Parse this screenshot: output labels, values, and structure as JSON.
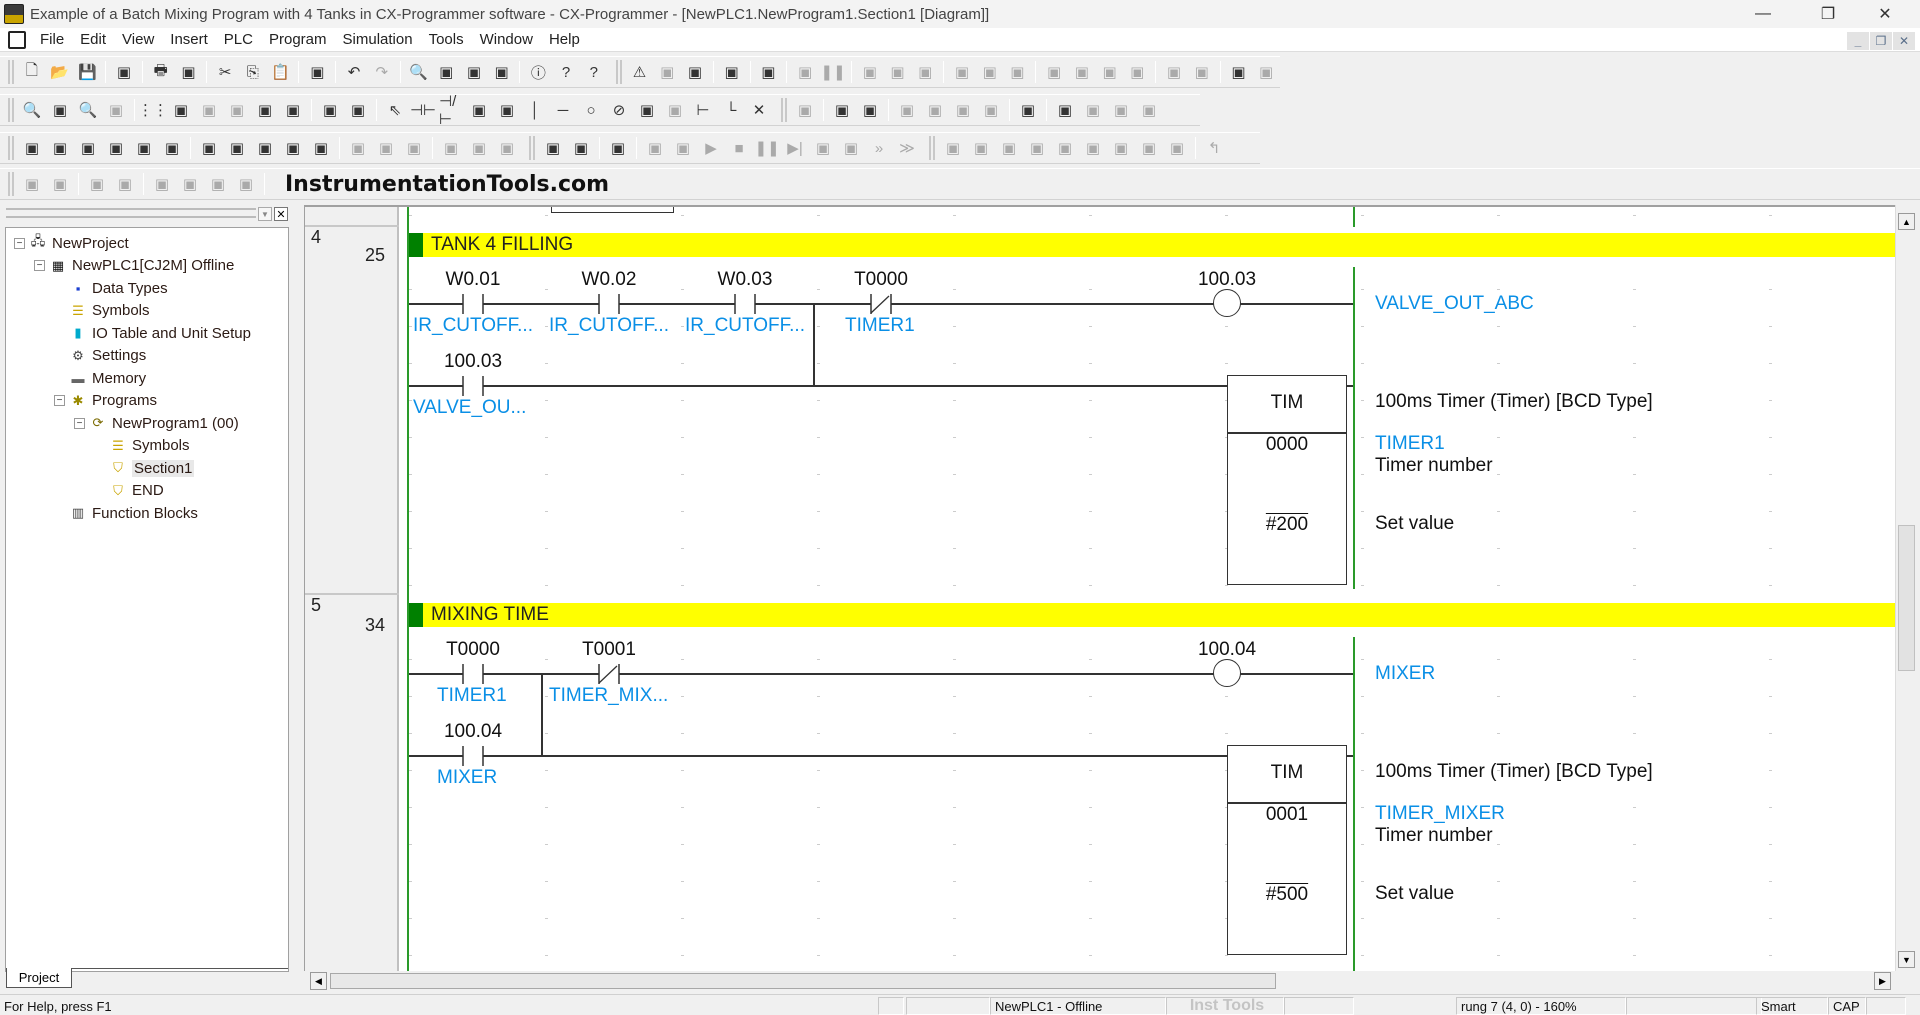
{
  "window": {
    "title": "Example of a Batch Mixing Program with 4 Tanks in CX-Programmer software - CX-Programmer - [NewPLC1.NewProgram1.Section1 [Diagram]]",
    "minimize": "—",
    "restore": "❐",
    "close": "✕"
  },
  "menu": {
    "items": [
      "File",
      "Edit",
      "View",
      "Insert",
      "PLC",
      "Program",
      "Simulation",
      "Tools",
      "Window",
      "Help"
    ],
    "mdi_minimize": "_",
    "mdi_restore": "❐",
    "mdi_close": "✕"
  },
  "toolbar": {
    "watermark": "InstrumentationTools.com",
    "row1": [
      "new-icon",
      "open-icon",
      "save-icon",
      "|",
      "print-preview-project-icon",
      "|",
      "print-icon",
      "print-preview-icon",
      "|",
      "cut-icon",
      "copy-icon",
      "paste-icon",
      "|",
      "paste-special-icon",
      "|",
      "undo-icon",
      "redo-icon",
      "|",
      "find-icon",
      "replace-icon",
      "address-reference-icon",
      "cross-reference-icon",
      "|",
      "info-icon",
      "help-icon",
      "whats-this-icon",
      "||",
      "compile-warning-icon",
      "online-compile-icon",
      "find-error-icon",
      "|",
      "program-check-icon",
      "|",
      "plc-check-icon",
      "|",
      "stop-monitoring-icon",
      "pause-icon",
      "|",
      "transfer-to-plc-icon",
      "transfer-from-plc-icon",
      "compare-icon",
      "|",
      "online-edit-icon",
      "online-edit-send-icon",
      "online-edit-cancel-icon",
      "|",
      "memory-card-icon",
      "data-trace-icon",
      "time-chart-icon",
      "memory-compare-icon",
      "|",
      "differential-monitor-icon",
      "io-monitor-icon",
      "|",
      "protect-icon",
      "release-protect-icon"
    ],
    "row2": [
      "zoom-out-icon",
      "zoom-fit-icon",
      "zoom-in-icon",
      "zoom-disabled-icon",
      "|",
      "grid-icon",
      "show-comments-icon",
      "rung-annotation-icon",
      "monitor-rungs-icon",
      "program-ladder-icon",
      "show-tree-icon",
      "|",
      "sma-icon",
      "ci-icon",
      "|",
      "select-icon",
      "contact-no-icon",
      "contact-nc-icon",
      "contact-or-no-icon",
      "contact-or-nc-icon",
      "vertical-line-icon",
      "horizontal-line-icon",
      "coil-no-icon",
      "coil-nc-icon",
      "instruction-icon",
      "ladder-block-icon",
      "branch-icon",
      "connect-line-icon",
      "delete-line-icon",
      "||",
      "simulation-icon",
      "|",
      "download-icon",
      "upload-icon",
      "|",
      "force-on-icon",
      "force-off-icon",
      "force-cancel-icon",
      "force-all-icon",
      "|",
      "io-table-icon",
      "|",
      "data-monitor-icon",
      "set-on-icon",
      "set-off-icon",
      "set-value-icon"
    ],
    "row3": [
      "project-window-icon",
      "build-icon",
      "ladder-view-icon",
      "mnemonic-view-icon",
      "output-window-icon",
      "properties-icon",
      "|",
      "cross-ref-icon",
      "symbols-window-icon",
      "io-comment-icon",
      "watch-window-icon",
      "address-icon",
      "|",
      "decimal-icon",
      "signed-decimal-icon",
      "hex-icon",
      "|",
      "step-in-icon",
      "step-out-icon",
      "step-over-icon",
      "||",
      "connect-online-icon",
      "work-online-icon",
      "|",
      "monitor-icon",
      "|",
      "hand-icon",
      "hand-step-icon",
      "run-icon",
      "stop-icon",
      "pause-icon",
      "step-icon",
      "step-in-sim-icon",
      "step-out-sim-icon",
      "fast-forward-icon",
      "last-step-icon",
      "||",
      "block-icon-1",
      "block-icon-2",
      "block-icon-3",
      "block-icon-4",
      "branch-icon-1",
      "branch-icon-2",
      "branch-icon-3",
      "branch-icon-4",
      "branch-icon-5",
      "|",
      "return-icon"
    ],
    "row4": [
      "indent-left-icon",
      "indent-right-icon",
      "|",
      "list-icon",
      "list-check-icon",
      "|",
      "action-icon-1",
      "action-icon-2",
      "action-icon-3",
      "action-icon-4"
    ]
  },
  "project_panel": {
    "tab": "Project",
    "tree": [
      {
        "label": "NewProject",
        "icon": "project-icon",
        "level": 0,
        "expanded": true
      },
      {
        "label": "NewPLC1[CJ2M] Offline",
        "icon": "plc-icon",
        "level": 1,
        "expanded": true
      },
      {
        "label": "Data Types",
        "icon": "data-types-icon",
        "level": 2
      },
      {
        "label": "Symbols",
        "icon": "symbols-icon",
        "level": 2
      },
      {
        "label": "IO Table and Unit Setup",
        "icon": "io-table-icon",
        "level": 2
      },
      {
        "label": "Settings",
        "icon": "settings-icon",
        "level": 2
      },
      {
        "label": "Memory",
        "icon": "memory-icon",
        "level": 2
      },
      {
        "label": "Programs",
        "icon": "programs-icon",
        "level": 2,
        "expanded": true
      },
      {
        "label": "NewProgram1 (00)",
        "icon": "program-icon",
        "level": 3,
        "expanded": true
      },
      {
        "label": "Symbols",
        "icon": "symbols-icon",
        "level": 4
      },
      {
        "label": "Section1",
        "icon": "section-icon",
        "level": 4,
        "selected": true
      },
      {
        "label": "END",
        "icon": "section-icon",
        "level": 4
      },
      {
        "label": "Function Blocks",
        "icon": "function-blocks-icon",
        "level": 2
      }
    ]
  },
  "diagram": {
    "colors": {
      "comment_bg": "#ffff00",
      "comment_marker": "#008000",
      "rail": "#2a9a2a",
      "symbol": "#0a8fe6"
    },
    "rungs": [
      {
        "rung": "4",
        "step": "25",
        "comment": "TANK 4 FILLING",
        "contacts": [
          {
            "address": "W0.01",
            "symbol": "IR_CUTOFF...",
            "type": "NO"
          },
          {
            "address": "W0.02",
            "symbol": "IR_CUTOFF...",
            "type": "NO"
          },
          {
            "address": "W0.03",
            "symbol": "IR_CUTOFF...",
            "type": "NO"
          },
          {
            "address": "T0000",
            "symbol": "TIMER1",
            "type": "NC"
          },
          {
            "address": "100.03",
            "symbol": "VALVE_OU...",
            "type": "NO",
            "branch": true
          }
        ],
        "coil": {
          "address": "100.03",
          "symbol": "VALVE_OUT_ABC"
        },
        "instruction": {
          "mnemonic": "TIM",
          "description": "100ms Timer (Timer) [BCD Type]",
          "operand1": "0000",
          "operand1_symbol": "TIMER1",
          "operand1_desc": "Timer number",
          "operand2": "#200",
          "operand2_desc": "Set value"
        }
      },
      {
        "rung": "5",
        "step": "34",
        "comment": "MIXING TIME",
        "contacts": [
          {
            "address": "T0000",
            "symbol": "TIMER1",
            "type": "NO"
          },
          {
            "address": "T0001",
            "symbol": "TIMER_MIX...",
            "type": "NC"
          },
          {
            "address": "100.04",
            "symbol": "MIXER",
            "type": "NO",
            "branch": true
          }
        ],
        "coil": {
          "address": "100.04",
          "symbol": "MIXER"
        },
        "instruction": {
          "mnemonic": "TIM",
          "description": "100ms Timer (Timer) [BCD Type]",
          "operand1": "0001",
          "operand1_symbol": "TIMER_MIXER",
          "operand1_desc": "Timer number",
          "operand2": "#500",
          "operand2_desc": "Set value"
        }
      }
    ]
  },
  "statusbar": {
    "help": "For Help, press F1",
    "plc": "NewPLC1 - Offline",
    "watermark": "Inst Tools",
    "position": "rung 7 (4, 0)  - 160%",
    "mode": "Smart",
    "caps": "CAP"
  }
}
